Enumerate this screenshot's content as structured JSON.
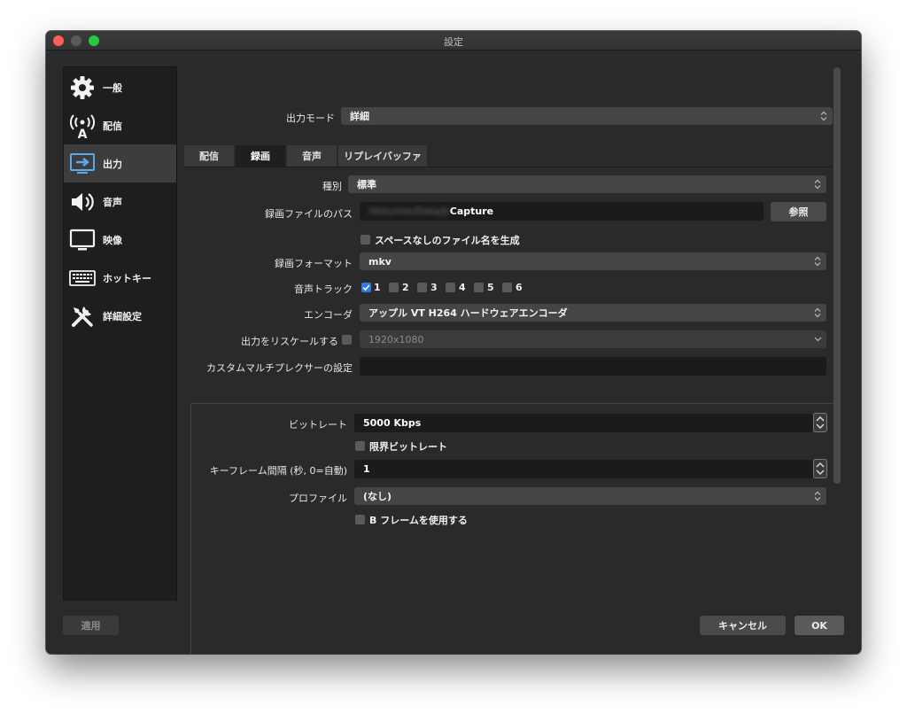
{
  "window": {
    "title": "設定"
  },
  "sidebar": {
    "items": [
      {
        "label": "一般",
        "icon": "gear-icon"
      },
      {
        "label": "配信",
        "icon": "broadcast-antenna-icon"
      },
      {
        "label": "出力",
        "icon": "output-monitor-icon",
        "active": true
      },
      {
        "label": "音声",
        "icon": "speaker-icon"
      },
      {
        "label": "映像",
        "icon": "monitor-icon"
      },
      {
        "label": "ホットキー",
        "icon": "keyboard-icon"
      },
      {
        "label": "詳細設定",
        "icon": "tools-icon"
      }
    ]
  },
  "output_mode": {
    "label": "出力モード",
    "value": "詳細"
  },
  "tabs": [
    {
      "label": "配信"
    },
    {
      "label": "録画",
      "active": true
    },
    {
      "label": "音声"
    },
    {
      "label": "リプレイバッファ"
    }
  ],
  "recording": {
    "type_label": "種別",
    "type_value": "標準",
    "path_label": "録画ファイルのパス",
    "path_value_blurred": "/Volumes/Data/Jr",
    "path_value": "Capture",
    "browse_label": "参照",
    "no_space_label": "スペースなしのファイル名を生成",
    "format_label": "録画フォーマット",
    "format_value": "mkv",
    "audio_track_label": "音声トラック",
    "tracks": [
      "1",
      "2",
      "3",
      "4",
      "5",
      "6"
    ],
    "tracks_checked": [
      true,
      false,
      false,
      false,
      false,
      false
    ],
    "encoder_label": "エンコーダ",
    "encoder_value": "アップル VT H264 ハードウェアエンコーダ",
    "rescale_label": "出力をリスケールする",
    "rescale_value": "1920x1080",
    "muxer_label": "カスタムマルチプレクサーの設定",
    "muxer_value": ""
  },
  "encoder_settings": {
    "bitrate_label": "ビットレート",
    "bitrate_value": "5000 Kbps",
    "cbr_label": "限界ビットレート",
    "keyframe_label": "キーフレーム間隔 (秒, 0=自動)",
    "keyframe_value": "1",
    "profile_label": "プロファイル",
    "profile_value": "(なし)",
    "bframes_label": "B フレームを使用する"
  },
  "footer": {
    "apply_label": "適用",
    "cancel_label": "キャンセル",
    "ok_label": "OK"
  },
  "colors": {
    "accent": "#2b7ae8",
    "window_bg": "#2a2a2a",
    "sidebar_bg": "#1e1e1e"
  }
}
